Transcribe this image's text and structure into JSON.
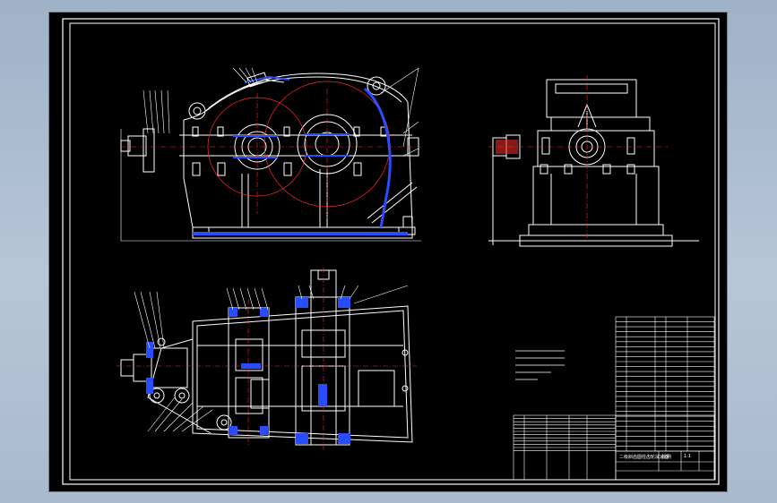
{
  "drawing": {
    "background": "#000000",
    "line_color": "#ffffff",
    "accent_colors": {
      "centerline": "#ff2a2a",
      "section": "#2a4cff",
      "pitch_circle": "#ff2a2a"
    }
  },
  "title_block": {
    "rows": 20,
    "label_a": "二级斜齿圆柱齿轮减速器",
    "label_b": "比例",
    "label_c": "1:1"
  },
  "parts_list": {
    "rows": 27
  },
  "tech_notes": {
    "lines": 5
  }
}
